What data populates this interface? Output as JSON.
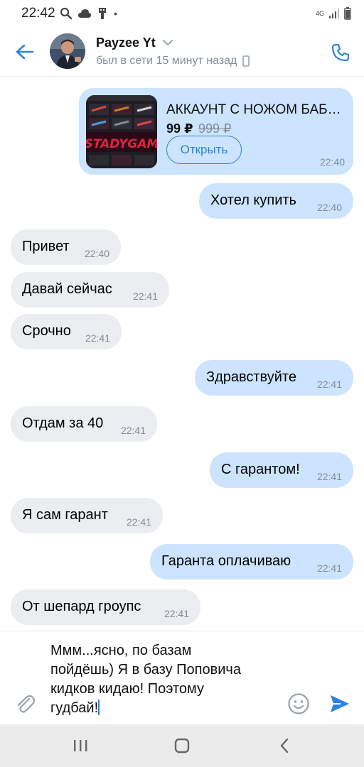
{
  "status_bar": {
    "time": "22:42",
    "network": "4G",
    "dot": "•",
    "icons": [
      "search-icon",
      "cloud-icon",
      "usb-icon",
      "signal-icon",
      "battery-icon"
    ]
  },
  "header": {
    "contact_name": "Payzee Yt",
    "last_seen": "был в сети 15 минут назад",
    "icons": [
      "back-arrow-icon",
      "chevron-down-icon",
      "phone-icon",
      "mobile-device-icon"
    ]
  },
  "product_card": {
    "title": "АККАУНТ С НОЖОМ БАБ…",
    "price": "99 ₽",
    "old_price": "999 ₽",
    "open_label": "Открыть",
    "time": "22:40",
    "thumb_caption": "STADYGAM"
  },
  "messages": [
    {
      "direction": "out",
      "text": "Хотел купить",
      "time": "22:40"
    },
    {
      "direction": "in",
      "text": "Привет",
      "time": "22:40"
    },
    {
      "direction": "in",
      "text": "Давай сейчас",
      "time": "22:41"
    },
    {
      "direction": "in",
      "text": "Срочно",
      "time": "22:41"
    },
    {
      "direction": "out",
      "text": "Здравствуйте",
      "time": "22:41"
    },
    {
      "direction": "in",
      "text": "Отдам за 40",
      "time": "22:41"
    },
    {
      "direction": "out",
      "text": "С гарантом!",
      "time": "22:41"
    },
    {
      "direction": "in",
      "text": "Я сам гарант",
      "time": "22:41"
    },
    {
      "direction": "out",
      "text": "Гаранта оплачиваю",
      "time": "22:41"
    },
    {
      "direction": "in",
      "text": "От шепард гроупс",
      "time": "22:41"
    }
  ],
  "composer": {
    "text": "Ммм...ясно, по базам\nпойдёшь) Я в базу Поповича\nкидков кидаю! Поэтому\nгудбай!",
    "icons": [
      "paperclip-icon",
      "smile-icon",
      "send-icon"
    ]
  },
  "nav_bar": {
    "icons": [
      "recent-apps-icon",
      "home-icon",
      "back-icon"
    ]
  },
  "colors": {
    "accent": "#2d81e0",
    "outgoing_bubble": "#cce4ff",
    "incoming_bubble": "#ebedf0",
    "secondary_text": "#818c99"
  }
}
